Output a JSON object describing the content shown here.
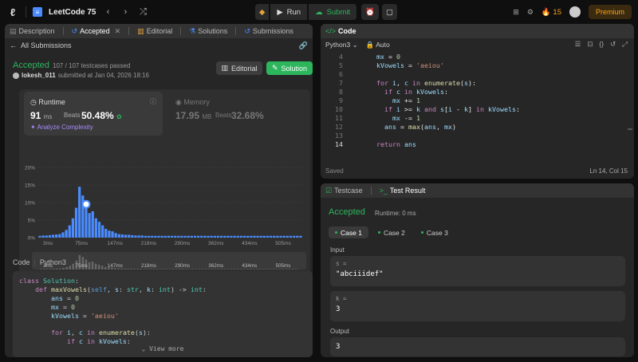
{
  "topbar": {
    "title": "LeetCode 75",
    "run_label": "Run",
    "submit_label": "Submit",
    "streak": "15",
    "premium_label": "Premium"
  },
  "left": {
    "tabs": [
      "Description",
      "Accepted",
      "Editorial",
      "Solutions",
      "Submissions"
    ],
    "back_label": "All Submissions",
    "status": "Accepted",
    "passed": "107 / 107 testcases passed",
    "user": "lokesh_011",
    "submitted_text": "submitted at Jan 04, 2026 18:16",
    "editorial_btn": "Editorial",
    "solution_btn": "Solution",
    "runtime": {
      "title": "Runtime",
      "value": "91",
      "unit": "ms",
      "beats_label": "Beats",
      "beats": "50.48%",
      "analyze": "Analyze Complexity"
    },
    "memory": {
      "title": "Memory",
      "value": "17.95",
      "unit": "MB",
      "beats_label": "Beats",
      "beats": "32.68%"
    },
    "code_label": "Code",
    "lang_label": "Python3",
    "view_more": "View more"
  },
  "chart_data": {
    "type": "bar",
    "yticks": [
      "20%",
      "15%",
      "10%",
      "5%",
      "0%"
    ],
    "ylim": [
      0,
      20
    ],
    "xticks": [
      "3ms",
      "75ms",
      "147ms",
      "218ms",
      "290ms",
      "362ms",
      "434ms",
      "505ms"
    ],
    "values": [
      0.5,
      0.6,
      0.6,
      0.7,
      0.8,
      0.9,
      1.0,
      1.5,
      2.2,
      3.5,
      5.5,
      8.5,
      14.5,
      12.0,
      9.5,
      7.0,
      7.5,
      5.5,
      4.5,
      3.5,
      2.5,
      2.0,
      1.8,
      1.3,
      1.0,
      0.9,
      0.8,
      0.8,
      0.7,
      0.6,
      0.6,
      0.6,
      0.5,
      0.5,
      0.5,
      0.5,
      0.5,
      0.5,
      0.5,
      0.5,
      0.5,
      0.5,
      0.5,
      0.5,
      0.5,
      0.5,
      0.5,
      0.5,
      0.5,
      0.5,
      0.5,
      0.5,
      0.5,
      0.5,
      0.5,
      0.5,
      0.5,
      0.5,
      0.5,
      0.5,
      0.5,
      0.5,
      0.5,
      0.5,
      0.5,
      0.5,
      0.5,
      0.5,
      0.5,
      0.5,
      0.5,
      0.5,
      0.5,
      0.5,
      0.5,
      0.5,
      0.5,
      0.5,
      0.5,
      0.5
    ],
    "highlight_index": 14,
    "bar_color": "#4a8cff"
  },
  "code_lines_left": [
    "class Solution:",
    "    def maxVowels(self, s: str, k: int) -> int:",
    "        ans = 0",
    "        mx = 0",
    "        kVowels = 'aeiou'",
    "",
    "        for i, c in enumerate(s):",
    "            if c in kVowels:"
  ],
  "code": {
    "tab": "Code",
    "lang": "Python3",
    "auto": "Auto",
    "saved": "Saved",
    "cursor": "Ln 14, Col 15",
    "start_line": 4,
    "current_line": 14,
    "lines": [
      "    mx = 0",
      "    kVowels = 'aeiou'",
      "",
      "    for i, c in enumerate(s):",
      "      if c in kVowels:",
      "        mx += 1",
      "      if i >= k and s[i - k] in kVowels:",
      "        mx -= 1",
      "      ans = max(ans, mx)",
      "",
      "    return ans"
    ]
  },
  "test": {
    "tab_testcase": "Testcase",
    "tab_result": "Test Result",
    "status": "Accepted",
    "runtime": "Runtime: 0 ms",
    "cases": [
      "Case 1",
      "Case 2",
      "Case 3"
    ],
    "input_label": "Input",
    "s_name": "s =",
    "s_value": "\"abciiidef\"",
    "k_name": "k =",
    "k_value": "3",
    "output_label": "Output",
    "output_value": "3"
  }
}
